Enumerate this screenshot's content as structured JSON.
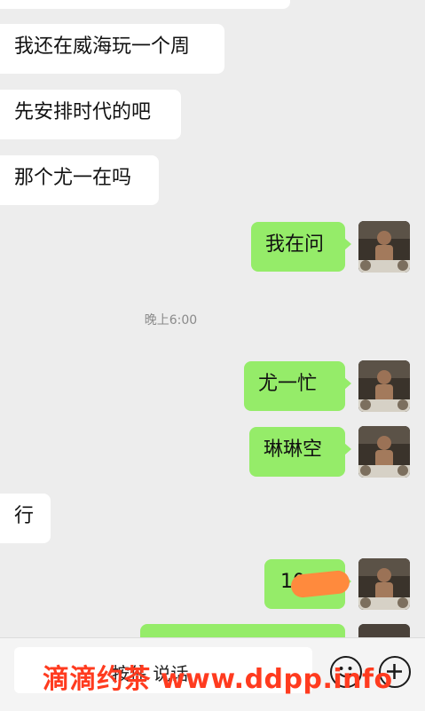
{
  "messages": [
    {
      "side": "in",
      "text": ""
    },
    {
      "side": "in",
      "text": "我还在威海玩一个周"
    },
    {
      "side": "in",
      "text": "先安排时代的吧"
    },
    {
      "side": "in",
      "text": "那个尤一在吗"
    },
    {
      "side": "out",
      "text": "我在问"
    },
    {
      "side": "out",
      "text": "尤一忙"
    },
    {
      "side": "out",
      "text": "琳琳空"
    },
    {
      "side": "in",
      "text": "行"
    },
    {
      "side": "out",
      "text": "10"
    },
    {
      "side": "out",
      "text": ""
    }
  ],
  "timestamp": "晚上6:00",
  "input": {
    "placeholder_visible": "按住 说话"
  },
  "icons": {
    "emoji": "emoji-icon",
    "add": "plus-circle-icon"
  },
  "watermark": "滴滴约茶 www.ddpp.info",
  "colors": {
    "background": "#ededed",
    "outgoing": "#95ec69",
    "incoming": "#ffffff",
    "mask": "#ff8a3d",
    "watermark": "#ff3b1f"
  }
}
